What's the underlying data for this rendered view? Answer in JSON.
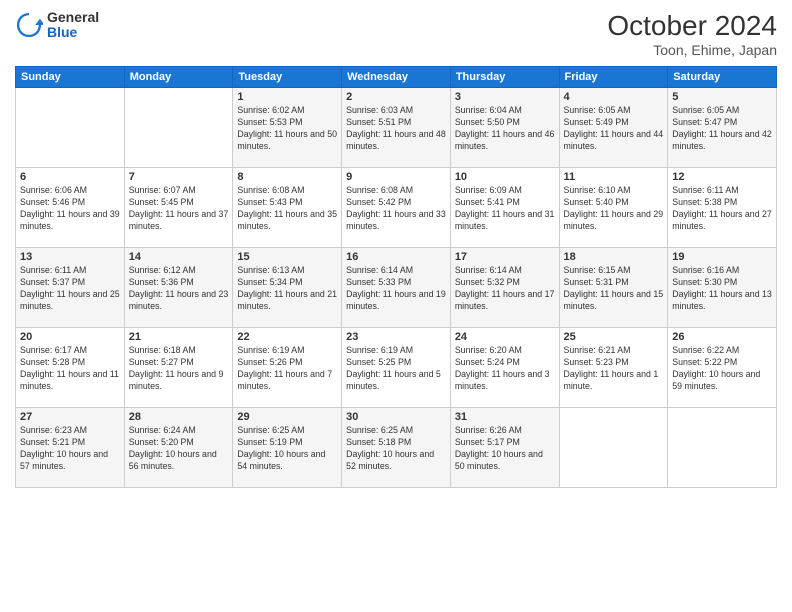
{
  "header": {
    "logo_general": "General",
    "logo_blue": "Blue",
    "month": "October 2024",
    "location": "Toon, Ehime, Japan"
  },
  "weekdays": [
    "Sunday",
    "Monday",
    "Tuesday",
    "Wednesday",
    "Thursday",
    "Friday",
    "Saturday"
  ],
  "weeks": [
    [
      {
        "day": "",
        "info": ""
      },
      {
        "day": "",
        "info": ""
      },
      {
        "day": "1",
        "info": "Sunrise: 6:02 AM\nSunset: 5:53 PM\nDaylight: 11 hours and 50 minutes."
      },
      {
        "day": "2",
        "info": "Sunrise: 6:03 AM\nSunset: 5:51 PM\nDaylight: 11 hours and 48 minutes."
      },
      {
        "day": "3",
        "info": "Sunrise: 6:04 AM\nSunset: 5:50 PM\nDaylight: 11 hours and 46 minutes."
      },
      {
        "day": "4",
        "info": "Sunrise: 6:05 AM\nSunset: 5:49 PM\nDaylight: 11 hours and 44 minutes."
      },
      {
        "day": "5",
        "info": "Sunrise: 6:05 AM\nSunset: 5:47 PM\nDaylight: 11 hours and 42 minutes."
      }
    ],
    [
      {
        "day": "6",
        "info": "Sunrise: 6:06 AM\nSunset: 5:46 PM\nDaylight: 11 hours and 39 minutes."
      },
      {
        "day": "7",
        "info": "Sunrise: 6:07 AM\nSunset: 5:45 PM\nDaylight: 11 hours and 37 minutes."
      },
      {
        "day": "8",
        "info": "Sunrise: 6:08 AM\nSunset: 5:43 PM\nDaylight: 11 hours and 35 minutes."
      },
      {
        "day": "9",
        "info": "Sunrise: 6:08 AM\nSunset: 5:42 PM\nDaylight: 11 hours and 33 minutes."
      },
      {
        "day": "10",
        "info": "Sunrise: 6:09 AM\nSunset: 5:41 PM\nDaylight: 11 hours and 31 minutes."
      },
      {
        "day": "11",
        "info": "Sunrise: 6:10 AM\nSunset: 5:40 PM\nDaylight: 11 hours and 29 minutes."
      },
      {
        "day": "12",
        "info": "Sunrise: 6:11 AM\nSunset: 5:38 PM\nDaylight: 11 hours and 27 minutes."
      }
    ],
    [
      {
        "day": "13",
        "info": "Sunrise: 6:11 AM\nSunset: 5:37 PM\nDaylight: 11 hours and 25 minutes."
      },
      {
        "day": "14",
        "info": "Sunrise: 6:12 AM\nSunset: 5:36 PM\nDaylight: 11 hours and 23 minutes."
      },
      {
        "day": "15",
        "info": "Sunrise: 6:13 AM\nSunset: 5:34 PM\nDaylight: 11 hours and 21 minutes."
      },
      {
        "day": "16",
        "info": "Sunrise: 6:14 AM\nSunset: 5:33 PM\nDaylight: 11 hours and 19 minutes."
      },
      {
        "day": "17",
        "info": "Sunrise: 6:14 AM\nSunset: 5:32 PM\nDaylight: 11 hours and 17 minutes."
      },
      {
        "day": "18",
        "info": "Sunrise: 6:15 AM\nSunset: 5:31 PM\nDaylight: 11 hours and 15 minutes."
      },
      {
        "day": "19",
        "info": "Sunrise: 6:16 AM\nSunset: 5:30 PM\nDaylight: 11 hours and 13 minutes."
      }
    ],
    [
      {
        "day": "20",
        "info": "Sunrise: 6:17 AM\nSunset: 5:28 PM\nDaylight: 11 hours and 11 minutes."
      },
      {
        "day": "21",
        "info": "Sunrise: 6:18 AM\nSunset: 5:27 PM\nDaylight: 11 hours and 9 minutes."
      },
      {
        "day": "22",
        "info": "Sunrise: 6:19 AM\nSunset: 5:26 PM\nDaylight: 11 hours and 7 minutes."
      },
      {
        "day": "23",
        "info": "Sunrise: 6:19 AM\nSunset: 5:25 PM\nDaylight: 11 hours and 5 minutes."
      },
      {
        "day": "24",
        "info": "Sunrise: 6:20 AM\nSunset: 5:24 PM\nDaylight: 11 hours and 3 minutes."
      },
      {
        "day": "25",
        "info": "Sunrise: 6:21 AM\nSunset: 5:23 PM\nDaylight: 11 hours and 1 minute."
      },
      {
        "day": "26",
        "info": "Sunrise: 6:22 AM\nSunset: 5:22 PM\nDaylight: 10 hours and 59 minutes."
      }
    ],
    [
      {
        "day": "27",
        "info": "Sunrise: 6:23 AM\nSunset: 5:21 PM\nDaylight: 10 hours and 57 minutes."
      },
      {
        "day": "28",
        "info": "Sunrise: 6:24 AM\nSunset: 5:20 PM\nDaylight: 10 hours and 56 minutes."
      },
      {
        "day": "29",
        "info": "Sunrise: 6:25 AM\nSunset: 5:19 PM\nDaylight: 10 hours and 54 minutes."
      },
      {
        "day": "30",
        "info": "Sunrise: 6:25 AM\nSunset: 5:18 PM\nDaylight: 10 hours and 52 minutes."
      },
      {
        "day": "31",
        "info": "Sunrise: 6:26 AM\nSunset: 5:17 PM\nDaylight: 10 hours and 50 minutes."
      },
      {
        "day": "",
        "info": ""
      },
      {
        "day": "",
        "info": ""
      }
    ]
  ]
}
